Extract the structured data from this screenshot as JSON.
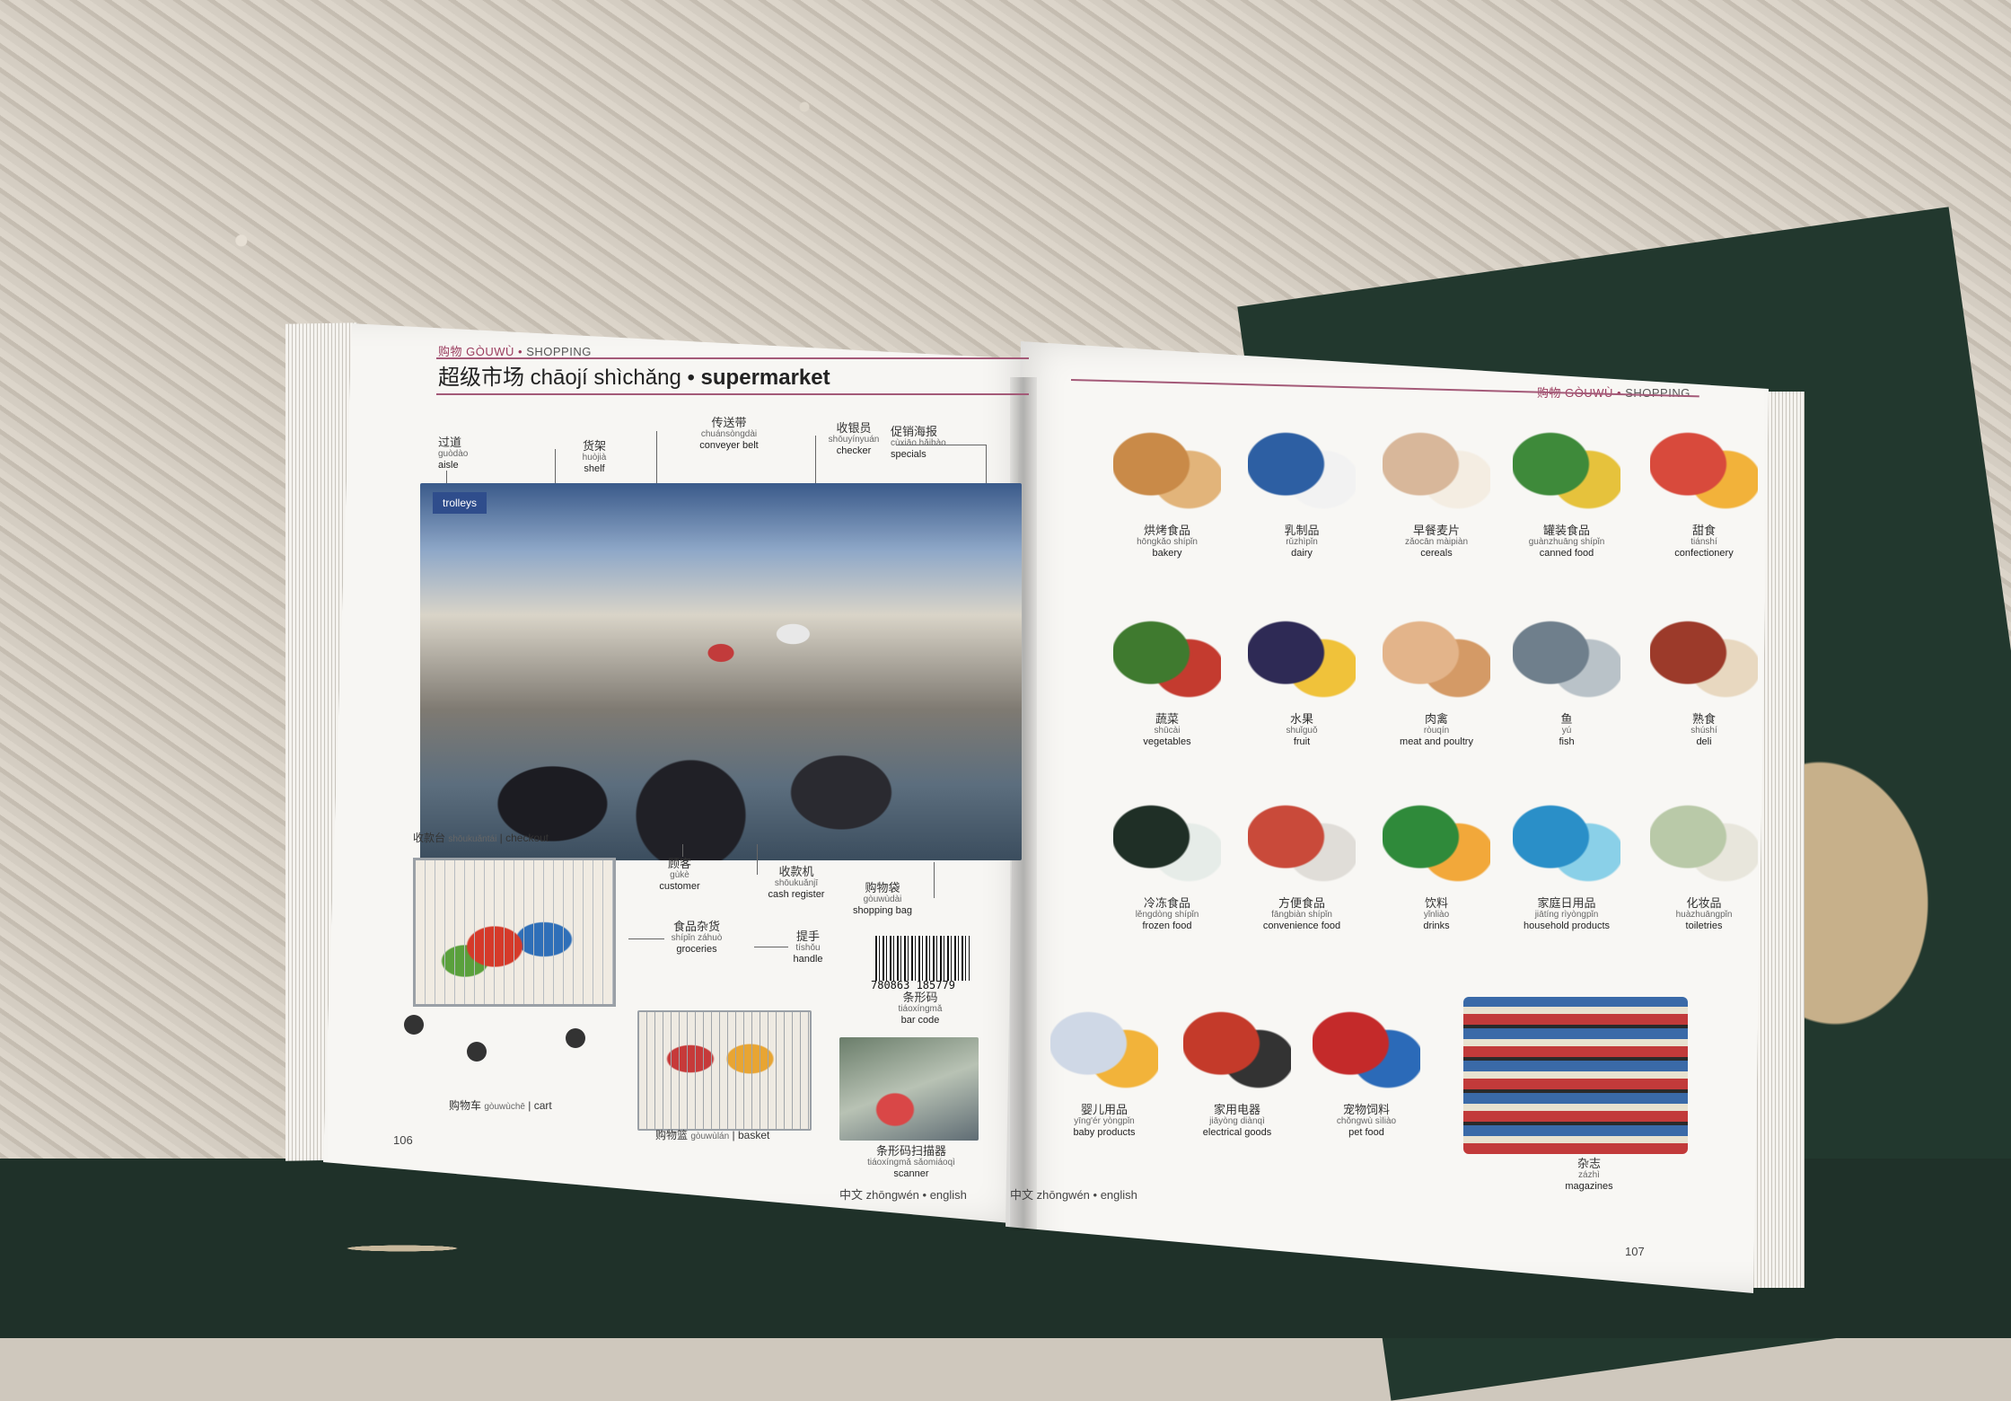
{
  "book": {
    "left_header": {
      "cn": "购物",
      "py": "GÒUWÙ",
      "en": "SHOPPING"
    },
    "right_header": {
      "cn": "购物",
      "py": "GÒUWÙ",
      "en": "SHOPPING"
    },
    "title": {
      "cn": "超级市场",
      "py": "chāojí shìchǎng",
      "en": "supermarket"
    },
    "left_page_number": "106",
    "right_page_number": "107",
    "left_footer": {
      "cn": "中文",
      "py": "zhōngwén",
      "en": "english"
    },
    "right_footer": {
      "cn": "中文",
      "py": "zhōngwén",
      "en": "english"
    },
    "store_sign": "trolleys",
    "barcode_digits": "780863 185779"
  },
  "left_labels": {
    "aisle": {
      "cn": "过道",
      "py": "guòdào",
      "en": "aisle"
    },
    "shelf": {
      "cn": "货架",
      "py": "huòjià",
      "en": "shelf"
    },
    "conveyor": {
      "cn": "传送带",
      "py": "chuánsòngdài",
      "en": "conveyer belt"
    },
    "checker": {
      "cn": "收银员",
      "py": "shōuyínyuán",
      "en": "checker"
    },
    "specials": {
      "cn": "促销海报",
      "py": "cùxiāo hǎibào",
      "en": "specials"
    },
    "checkout": {
      "cn": "收款台",
      "py": "shōukuǎntái",
      "en": "checkout"
    },
    "customer": {
      "cn": "顾客",
      "py": "gùkè",
      "en": "customer"
    },
    "register": {
      "cn": "收款机",
      "py": "shōukuǎnjī",
      "en": "cash register"
    },
    "bag": {
      "cn": "购物袋",
      "py": "gòuwùdài",
      "en": "shopping bag"
    },
    "groceries": {
      "cn": "食品杂货",
      "py": "shípǐn záhuò",
      "en": "groceries"
    },
    "handle": {
      "cn": "提手",
      "py": "tíshǒu",
      "en": "handle"
    },
    "barcode": {
      "cn": "条形码",
      "py": "tiáoxíngmǎ",
      "en": "bar code"
    },
    "cart": {
      "cn": "购物车",
      "py": "gòuwùchē",
      "en": "cart"
    },
    "basket": {
      "cn": "购物篮",
      "py": "gòuwùlán",
      "en": "basket"
    },
    "scanner": {
      "cn": "条形码扫描器",
      "py": "tiáoxíngmǎ sǎomiáoqì",
      "en": "scanner"
    }
  },
  "right_items": [
    {
      "cn": "烘烤食品",
      "py": "hōngkǎo shípǐn",
      "en": "bakery"
    },
    {
      "cn": "乳制品",
      "py": "rǔzhìpǐn",
      "en": "dairy"
    },
    {
      "cn": "早餐麦片",
      "py": "zǎocān màipiàn",
      "en": "cereals"
    },
    {
      "cn": "罐装食品",
      "py": "guànzhuāng shípǐn",
      "en": "canned food"
    },
    {
      "cn": "甜食",
      "py": "tiánshí",
      "en": "confectionery"
    },
    {
      "cn": "蔬菜",
      "py": "shūcài",
      "en": "vegetables"
    },
    {
      "cn": "水果",
      "py": "shuǐguǒ",
      "en": "fruit"
    },
    {
      "cn": "肉禽",
      "py": "ròuqín",
      "en": "meat and poultry"
    },
    {
      "cn": "鱼",
      "py": "yú",
      "en": "fish"
    },
    {
      "cn": "熟食",
      "py": "shúshí",
      "en": "deli"
    },
    {
      "cn": "冷冻食品",
      "py": "lěngdòng shípǐn",
      "en": "frozen food"
    },
    {
      "cn": "方便食品",
      "py": "fāngbiàn shípǐn",
      "en": "convenience food"
    },
    {
      "cn": "饮料",
      "py": "yǐnliào",
      "en": "drinks"
    },
    {
      "cn": "家庭日用品",
      "py": "jiātíng rìyòngpǐn",
      "en": "household products"
    },
    {
      "cn": "化妆品",
      "py": "huàzhuāngpǐn",
      "en": "toiletries"
    },
    {
      "cn": "婴儿用品",
      "py": "yīng'ér yòngpǐn",
      "en": "baby products"
    },
    {
      "cn": "家用电器",
      "py": "jiāyòng diànqì",
      "en": "electrical goods"
    },
    {
      "cn": "宠物饲料",
      "py": "chǒngwù sìliào",
      "en": "pet food"
    },
    {
      "cn": "杂志",
      "py": "zázhì",
      "en": "magazines"
    }
  ],
  "colors": {
    "accent": "#a45a78",
    "page": "#f7f6f3",
    "carpet": "#cfc8bd",
    "rug": "#22382e"
  }
}
